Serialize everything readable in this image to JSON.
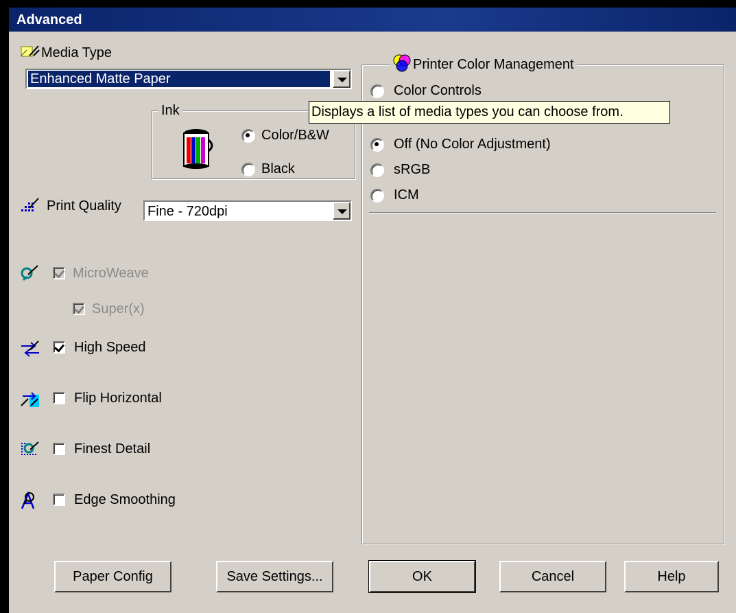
{
  "window": {
    "title": "Advanced"
  },
  "media_type": {
    "label": "Media Type",
    "selected": "Enhanced Matte Paper"
  },
  "ink": {
    "group_label": "Ink",
    "options": [
      "Color/B&W",
      "Black"
    ],
    "selected": "Color/B&W"
  },
  "print_quality": {
    "label": "Print Quality",
    "selected": "Fine - 720dpi"
  },
  "options": {
    "microweave": {
      "label": "MicroWeave",
      "checked": true,
      "enabled": false
    },
    "super": {
      "label": "Super(x)",
      "checked": true,
      "enabled": false
    },
    "high_speed": {
      "label": "High Speed",
      "checked": true,
      "enabled": true
    },
    "flip_horizontal": {
      "label": "Flip Horizontal",
      "checked": false,
      "enabled": true
    },
    "finest_detail": {
      "label": "Finest Detail",
      "checked": false,
      "enabled": true
    },
    "edge_smoothing": {
      "label": "Edge Smoothing",
      "checked": false,
      "enabled": true
    }
  },
  "color_management": {
    "group_label": "Printer Color Management",
    "options": [
      "Color Controls",
      "Off (No Color Adjustment)",
      "sRGB",
      "ICM"
    ],
    "selected": "Off (No Color Adjustment)"
  },
  "tooltip": "Displays a list of media types you can choose from.",
  "buttons": {
    "paper_config": "Paper Config",
    "save_settings": "Save Settings...",
    "ok": "OK",
    "cancel": "Cancel",
    "help": "Help"
  },
  "colors": {
    "titlebar": "#0a246a",
    "face": "#d4d0c8",
    "tooltip_bg": "#ffffe1"
  }
}
